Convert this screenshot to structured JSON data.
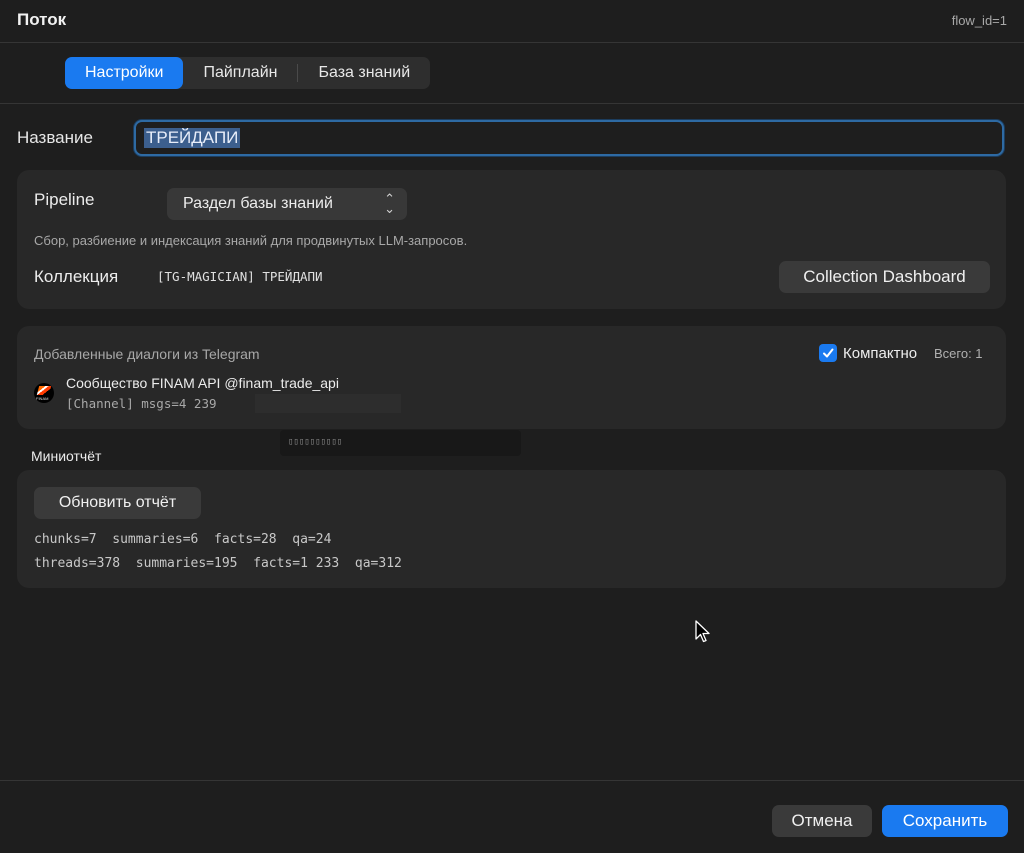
{
  "window": {
    "title": "Поток",
    "flow_id": "flow_id=1"
  },
  "tabs": [
    {
      "label": "Настройки",
      "active": true
    },
    {
      "label": "Пайплайн",
      "active": false
    },
    {
      "label": "База знаний",
      "active": false
    }
  ],
  "name_field": {
    "label": "Название",
    "value": "ТРЕЙДАПИ"
  },
  "pipeline": {
    "label": "Pipeline",
    "selected": "Раздел базы знаний",
    "description": "Сбор, разбиение и индексация знаний для продвинутых LLM-запросов.",
    "collection_label": "Коллекция",
    "collection_value": "[TG-MAGICIAN] ТРЕЙДАПИ",
    "dashboard_button": "Collection Dashboard"
  },
  "telegram": {
    "title": "Добавленные диалоги из Telegram",
    "compact_label": "Компактно",
    "compact_checked": true,
    "total": "Всего: 1",
    "dialogs": [
      {
        "name": "Сообщество FINAM API @finam_trade_api",
        "meta": "[Channel]  msgs=4 239",
        "avatar_text": "FINAM"
      }
    ]
  },
  "tooltip": {
    "text": "▯▯▯▯▯▯▯▯▯▯"
  },
  "mini_report": {
    "label": "Миниотчёт",
    "refresh_button": "Обновить отчёт",
    "line1": "chunks=7  summaries=6  facts=28  qa=24",
    "line2": "threads=378  summaries=195  facts=1 233  qa=312"
  },
  "footer": {
    "cancel": "Отмена",
    "save": "Сохранить"
  },
  "colors": {
    "accent": "#1a7af0",
    "background": "#1e1e1e",
    "card": "#282828",
    "focus_ring": "#2e6aa3"
  }
}
